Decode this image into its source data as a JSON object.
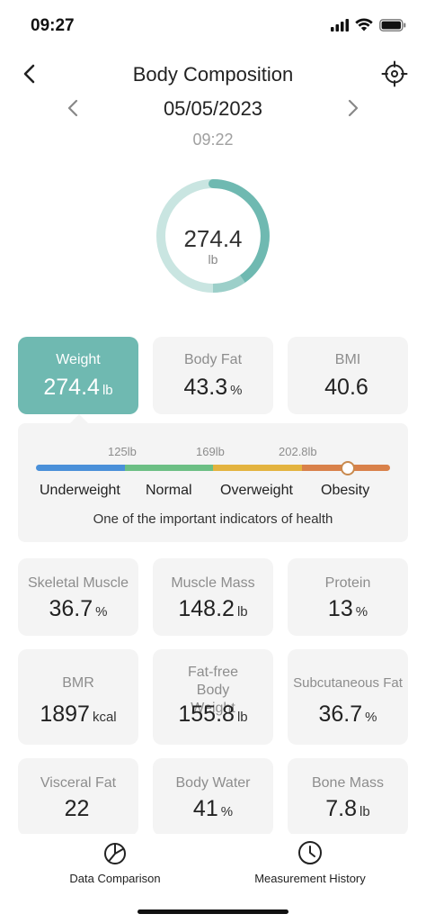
{
  "status": {
    "time": "09:27"
  },
  "nav": {
    "title": "Body Composition"
  },
  "date": {
    "date": "05/05/2023",
    "time": "09:22"
  },
  "gauge": {
    "value": "274.4",
    "unit": "lb"
  },
  "colors": {
    "accent": "#6fb9b1",
    "underweight": "#4a90d9",
    "normal": "#6cbf84",
    "overweight": "#e3b33f",
    "obesity": "#d9814a"
  },
  "top_metrics": [
    {
      "label": "Weight",
      "value": "274.4",
      "unit": "lb"
    },
    {
      "label": "Body Fat",
      "value": "43.3",
      "unit": "%"
    },
    {
      "label": "BMI",
      "value": "40.6",
      "unit": ""
    }
  ],
  "range": {
    "ticks": [
      "125lb",
      "169lb",
      "202.8lb"
    ],
    "categories": [
      "Underweight",
      "Normal",
      "Overweight",
      "Obesity"
    ],
    "note": "One of the important indicators of health",
    "marker_fraction": 0.88
  },
  "metrics_row1": [
    {
      "label": "Skeletal Muscle",
      "value": "36.7",
      "unit": "%"
    },
    {
      "label": "Muscle Mass",
      "value": "148.2",
      "unit": "lb"
    },
    {
      "label": "Protein",
      "value": "13",
      "unit": "%"
    }
  ],
  "metrics_row2": [
    {
      "label": "BMR",
      "value": "1897",
      "unit": "kcal"
    },
    {
      "label": "Fat-free Body Weight",
      "value": "155.8",
      "unit": "lb"
    },
    {
      "label": "Subcutaneous Fat",
      "value": "36.7",
      "unit": "%"
    }
  ],
  "metrics_row3": [
    {
      "label": "Visceral Fat",
      "value": "22",
      "unit": ""
    },
    {
      "label": "Body Water",
      "value": "41",
      "unit": "%"
    },
    {
      "label": "Bone Mass",
      "value": "7.8",
      "unit": "lb"
    }
  ],
  "bottom_tabs": [
    {
      "label": "Data Comparison",
      "icon": "pie-chart-icon"
    },
    {
      "label": "Measurement History",
      "icon": "clock-icon"
    }
  ]
}
